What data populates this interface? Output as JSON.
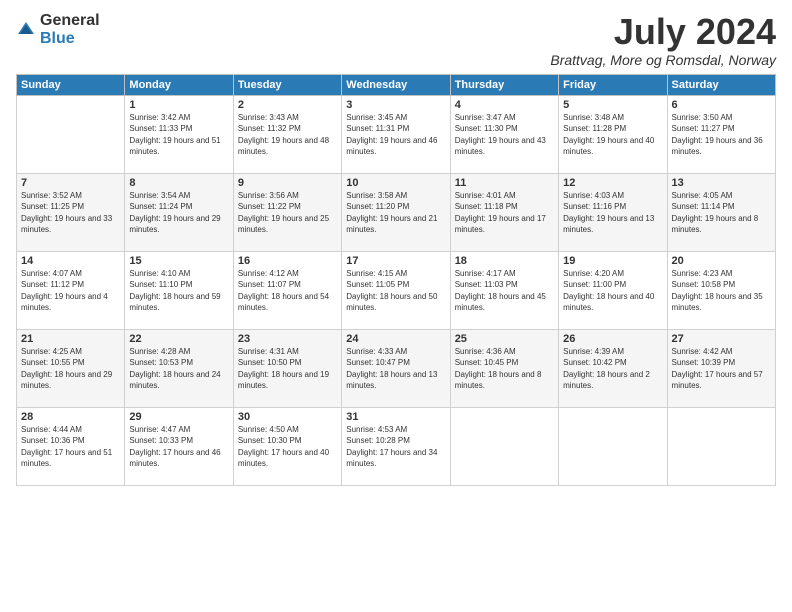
{
  "logo": {
    "general": "General",
    "blue": "Blue"
  },
  "header": {
    "month": "July 2024",
    "location": "Brattvag, More og Romsdal, Norway"
  },
  "weekdays": [
    "Sunday",
    "Monday",
    "Tuesday",
    "Wednesday",
    "Thursday",
    "Friday",
    "Saturday"
  ],
  "weeks": [
    [
      {
        "day": "",
        "sunrise": "",
        "sunset": "",
        "daylight": ""
      },
      {
        "day": "1",
        "sunrise": "Sunrise: 3:42 AM",
        "sunset": "Sunset: 11:33 PM",
        "daylight": "Daylight: 19 hours and 51 minutes."
      },
      {
        "day": "2",
        "sunrise": "Sunrise: 3:43 AM",
        "sunset": "Sunset: 11:32 PM",
        "daylight": "Daylight: 19 hours and 48 minutes."
      },
      {
        "day": "3",
        "sunrise": "Sunrise: 3:45 AM",
        "sunset": "Sunset: 11:31 PM",
        "daylight": "Daylight: 19 hours and 46 minutes."
      },
      {
        "day": "4",
        "sunrise": "Sunrise: 3:47 AM",
        "sunset": "Sunset: 11:30 PM",
        "daylight": "Daylight: 19 hours and 43 minutes."
      },
      {
        "day": "5",
        "sunrise": "Sunrise: 3:48 AM",
        "sunset": "Sunset: 11:28 PM",
        "daylight": "Daylight: 19 hours and 40 minutes."
      },
      {
        "day": "6",
        "sunrise": "Sunrise: 3:50 AM",
        "sunset": "Sunset: 11:27 PM",
        "daylight": "Daylight: 19 hours and 36 minutes."
      }
    ],
    [
      {
        "day": "7",
        "sunrise": "Sunrise: 3:52 AM",
        "sunset": "Sunset: 11:25 PM",
        "daylight": "Daylight: 19 hours and 33 minutes."
      },
      {
        "day": "8",
        "sunrise": "Sunrise: 3:54 AM",
        "sunset": "Sunset: 11:24 PM",
        "daylight": "Daylight: 19 hours and 29 minutes."
      },
      {
        "day": "9",
        "sunrise": "Sunrise: 3:56 AM",
        "sunset": "Sunset: 11:22 PM",
        "daylight": "Daylight: 19 hours and 25 minutes."
      },
      {
        "day": "10",
        "sunrise": "Sunrise: 3:58 AM",
        "sunset": "Sunset: 11:20 PM",
        "daylight": "Daylight: 19 hours and 21 minutes."
      },
      {
        "day": "11",
        "sunrise": "Sunrise: 4:01 AM",
        "sunset": "Sunset: 11:18 PM",
        "daylight": "Daylight: 19 hours and 17 minutes."
      },
      {
        "day": "12",
        "sunrise": "Sunrise: 4:03 AM",
        "sunset": "Sunset: 11:16 PM",
        "daylight": "Daylight: 19 hours and 13 minutes."
      },
      {
        "day": "13",
        "sunrise": "Sunrise: 4:05 AM",
        "sunset": "Sunset: 11:14 PM",
        "daylight": "Daylight: 19 hours and 8 minutes."
      }
    ],
    [
      {
        "day": "14",
        "sunrise": "Sunrise: 4:07 AM",
        "sunset": "Sunset: 11:12 PM",
        "daylight": "Daylight: 19 hours and 4 minutes."
      },
      {
        "day": "15",
        "sunrise": "Sunrise: 4:10 AM",
        "sunset": "Sunset: 11:10 PM",
        "daylight": "Daylight: 18 hours and 59 minutes."
      },
      {
        "day": "16",
        "sunrise": "Sunrise: 4:12 AM",
        "sunset": "Sunset: 11:07 PM",
        "daylight": "Daylight: 18 hours and 54 minutes."
      },
      {
        "day": "17",
        "sunrise": "Sunrise: 4:15 AM",
        "sunset": "Sunset: 11:05 PM",
        "daylight": "Daylight: 18 hours and 50 minutes."
      },
      {
        "day": "18",
        "sunrise": "Sunrise: 4:17 AM",
        "sunset": "Sunset: 11:03 PM",
        "daylight": "Daylight: 18 hours and 45 minutes."
      },
      {
        "day": "19",
        "sunrise": "Sunrise: 4:20 AM",
        "sunset": "Sunset: 11:00 PM",
        "daylight": "Daylight: 18 hours and 40 minutes."
      },
      {
        "day": "20",
        "sunrise": "Sunrise: 4:23 AM",
        "sunset": "Sunset: 10:58 PM",
        "daylight": "Daylight: 18 hours and 35 minutes."
      }
    ],
    [
      {
        "day": "21",
        "sunrise": "Sunrise: 4:25 AM",
        "sunset": "Sunset: 10:55 PM",
        "daylight": "Daylight: 18 hours and 29 minutes."
      },
      {
        "day": "22",
        "sunrise": "Sunrise: 4:28 AM",
        "sunset": "Sunset: 10:53 PM",
        "daylight": "Daylight: 18 hours and 24 minutes."
      },
      {
        "day": "23",
        "sunrise": "Sunrise: 4:31 AM",
        "sunset": "Sunset: 10:50 PM",
        "daylight": "Daylight: 18 hours and 19 minutes."
      },
      {
        "day": "24",
        "sunrise": "Sunrise: 4:33 AM",
        "sunset": "Sunset: 10:47 PM",
        "daylight": "Daylight: 18 hours and 13 minutes."
      },
      {
        "day": "25",
        "sunrise": "Sunrise: 4:36 AM",
        "sunset": "Sunset: 10:45 PM",
        "daylight": "Daylight: 18 hours and 8 minutes."
      },
      {
        "day": "26",
        "sunrise": "Sunrise: 4:39 AM",
        "sunset": "Sunset: 10:42 PM",
        "daylight": "Daylight: 18 hours and 2 minutes."
      },
      {
        "day": "27",
        "sunrise": "Sunrise: 4:42 AM",
        "sunset": "Sunset: 10:39 PM",
        "daylight": "Daylight: 17 hours and 57 minutes."
      }
    ],
    [
      {
        "day": "28",
        "sunrise": "Sunrise: 4:44 AM",
        "sunset": "Sunset: 10:36 PM",
        "daylight": "Daylight: 17 hours and 51 minutes."
      },
      {
        "day": "29",
        "sunrise": "Sunrise: 4:47 AM",
        "sunset": "Sunset: 10:33 PM",
        "daylight": "Daylight: 17 hours and 46 minutes."
      },
      {
        "day": "30",
        "sunrise": "Sunrise: 4:50 AM",
        "sunset": "Sunset: 10:30 PM",
        "daylight": "Daylight: 17 hours and 40 minutes."
      },
      {
        "day": "31",
        "sunrise": "Sunrise: 4:53 AM",
        "sunset": "Sunset: 10:28 PM",
        "daylight": "Daylight: 17 hours and 34 minutes."
      },
      {
        "day": "",
        "sunrise": "",
        "sunset": "",
        "daylight": ""
      },
      {
        "day": "",
        "sunrise": "",
        "sunset": "",
        "daylight": ""
      },
      {
        "day": "",
        "sunrise": "",
        "sunset": "",
        "daylight": ""
      }
    ]
  ]
}
